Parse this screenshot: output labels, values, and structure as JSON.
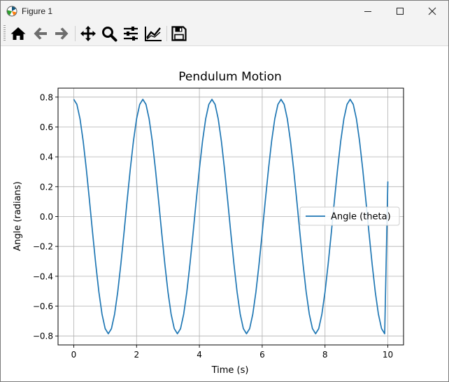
{
  "window": {
    "title": "Figure 1",
    "controls": [
      "minimize-icon",
      "maximize-icon",
      "close-icon"
    ]
  },
  "toolbar": {
    "buttons": [
      "home-icon",
      "back-arrow-icon",
      "forward-arrow-icon",
      "pan-icon",
      "zoom-icon",
      "subplots-icon",
      "axes-edit-icon",
      "save-icon"
    ]
  },
  "chart_data": {
    "type": "line",
    "title": "Pendulum Motion",
    "xlabel": "Time (s)",
    "ylabel": "Angle (radians)",
    "xlim": [
      -0.5,
      10.5
    ],
    "ylim": [
      -0.86,
      0.86
    ],
    "xticks": [
      0,
      2,
      4,
      6,
      8,
      10
    ],
    "yticks": [
      -0.8,
      -0.6,
      -0.4,
      -0.2,
      0.0,
      0.2,
      0.4,
      0.6,
      0.8
    ],
    "xtick_labels": [
      "0",
      "2",
      "4",
      "6",
      "8",
      "10"
    ],
    "ytick_labels": [
      "−0.8",
      "−0.6",
      "−0.4",
      "−0.2",
      "0.0",
      "0.2",
      "0.4",
      "0.6",
      "0.8"
    ],
    "grid": true,
    "legend": {
      "position": "center-right"
    },
    "series": [
      {
        "name": "Angle (theta)",
        "color": "#1f77b4",
        "x": [
          0.0,
          0.1,
          0.2,
          0.3,
          0.4,
          0.5,
          0.6,
          0.7,
          0.8,
          0.9,
          1.0,
          1.1,
          1.2,
          1.3,
          1.4,
          1.5,
          1.6,
          1.7,
          1.8,
          1.9,
          2.0,
          2.1,
          2.2,
          2.3,
          2.4,
          2.5,
          2.6,
          2.7,
          2.8,
          2.9,
          3.0,
          3.1,
          3.2,
          3.3,
          3.4,
          3.5,
          3.6,
          3.7,
          3.8,
          3.9,
          4.0,
          4.1,
          4.2,
          4.3,
          4.4,
          4.5,
          4.6,
          4.7,
          4.8,
          4.9,
          5.0,
          5.1,
          5.2,
          5.3,
          5.4,
          5.5,
          5.6,
          5.7,
          5.8,
          5.9,
          6.0,
          6.1,
          6.2,
          6.3,
          6.4,
          6.5,
          6.6,
          6.7,
          6.8,
          6.9,
          7.0,
          7.1,
          7.2,
          7.3,
          7.4,
          7.5,
          7.6,
          7.7,
          7.8,
          7.9,
          8.0,
          8.1,
          8.2,
          8.3,
          8.4,
          8.5,
          8.6,
          8.7,
          8.8,
          8.9,
          9.0,
          9.1,
          9.2,
          9.3,
          9.4,
          9.5,
          9.6,
          9.7,
          9.8,
          9.9,
          10.0
        ],
        "y": [
          0.785,
          0.751,
          0.654,
          0.505,
          0.318,
          0.109,
          -0.109,
          -0.318,
          -0.505,
          -0.654,
          -0.751,
          -0.785,
          -0.751,
          -0.654,
          -0.505,
          -0.318,
          -0.109,
          0.109,
          0.318,
          0.505,
          0.654,
          0.751,
          0.785,
          0.751,
          0.654,
          0.505,
          0.318,
          0.109,
          -0.109,
          -0.318,
          -0.505,
          -0.654,
          -0.751,
          -0.785,
          -0.751,
          -0.654,
          -0.505,
          -0.318,
          -0.109,
          0.109,
          0.318,
          0.505,
          0.654,
          0.751,
          0.785,
          0.751,
          0.654,
          0.505,
          0.318,
          0.109,
          -0.109,
          -0.318,
          -0.505,
          -0.654,
          -0.751,
          -0.785,
          -0.751,
          -0.654,
          -0.505,
          -0.318,
          -0.109,
          0.109,
          0.318,
          0.505,
          0.654,
          0.751,
          0.785,
          0.751,
          0.654,
          0.505,
          0.318,
          0.109,
          -0.109,
          -0.318,
          -0.505,
          -0.654,
          -0.751,
          -0.785,
          -0.751,
          -0.654,
          -0.505,
          -0.318,
          -0.109,
          0.109,
          0.318,
          0.505,
          0.654,
          0.751,
          0.785,
          0.751,
          0.654,
          0.505,
          0.318,
          0.109,
          -0.109,
          -0.318,
          -0.505,
          -0.654,
          -0.751,
          -0.785,
          0.235
        ]
      }
    ]
  }
}
